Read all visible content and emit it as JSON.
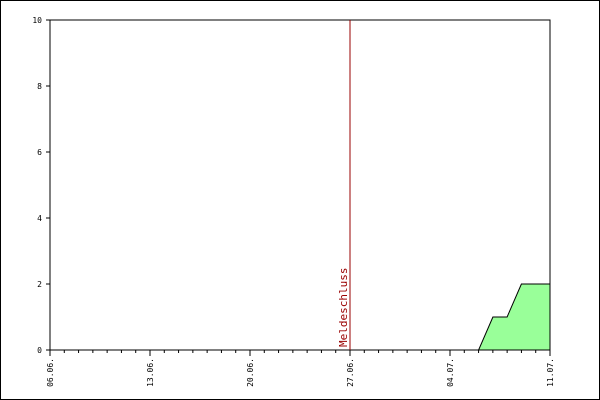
{
  "chart_data": {
    "type": "area",
    "x_ticks": [
      "06.06.",
      "13.06.",
      "20.06.",
      "27.06.",
      "04.07.",
      "11.07."
    ],
    "y_ticks": [
      0,
      2,
      4,
      6,
      8,
      10
    ],
    "ylim": [
      0,
      10
    ],
    "xlim": [
      "06.06.",
      "11.07."
    ],
    "x": [
      "06.06.",
      "06.07.",
      "07.07.",
      "08.07.",
      "09.07.",
      "10.07.",
      "11.07."
    ],
    "values": [
      0,
      0,
      1,
      1,
      2,
      2,
      2
    ],
    "annotations": [
      {
        "text": "Meldeschluss",
        "x": "27.06."
      }
    ],
    "grid": false,
    "colors": {
      "fill": "#99ff99",
      "line": "#000000",
      "marker_line": "#990000",
      "marker_text": "#990000"
    }
  }
}
